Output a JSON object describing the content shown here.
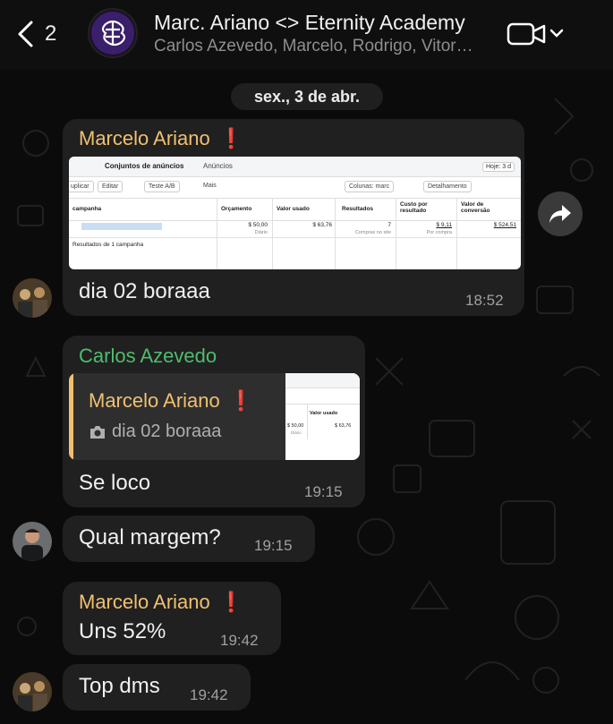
{
  "header": {
    "back_count": "2",
    "title": "Marc. Ariano <> Eternity Academy",
    "subtitle": "Carlos Azevedo, Marcelo, Rodrigo, Vitor…"
  },
  "date_separator": "sex., 3 de abr.",
  "messages": [
    {
      "sender": "Marcelo Ariano",
      "sender_badge": "❗",
      "text": "dia 02 boraaa",
      "time": "18:52",
      "image": {
        "tabs": [
          "Conjuntos de anúncios",
          "Anúncios"
        ],
        "date_button": "Hoje: 3 d",
        "toolbar": [
          "uplicar",
          "Editar",
          "Teste A/B",
          "Mais",
          "Colunas: marc",
          "Detalhamento"
        ],
        "columns": [
          "campanha",
          "Orçamento",
          "Valor usado",
          "Resultados",
          "Custo por resultado",
          "Valor de conversão"
        ],
        "row": {
          "orcamento": "$ 50,00",
          "orcamento_sub": "Diário",
          "valor_usado": "$ 63,76",
          "resultados": "7",
          "resultados_sub": "Compras no site",
          "custo": "$ 9,11",
          "custo_sub": "Por compra",
          "conversao": "$ 524,51"
        },
        "summary": "Resultados de 1 campanha"
      }
    },
    {
      "sender": "Carlos Azevedo",
      "quote": {
        "sender": "Marcelo Ariano",
        "sender_badge": "❗",
        "text": "dia 02 boraaa",
        "thumb": {
          "col1": "Valor usado",
          "v1": "$ 50,00",
          "v1_sub": "Diário",
          "v2": "$ 63,76"
        }
      },
      "text": "Se loco",
      "time": "19:15"
    },
    {
      "text": "Qual margem?",
      "time": "19:15"
    },
    {
      "sender": "Marcelo Ariano",
      "sender_badge": "❗",
      "text": "Uns 52%",
      "time": "19:42"
    },
    {
      "text": "Top dms",
      "time": "19:42"
    }
  ],
  "icons": {
    "back": "chevron-left-icon",
    "video": "video-camera-icon",
    "forward": "forward-icon",
    "camera": "camera-icon"
  },
  "colors": {
    "orange_sender": "#f0c070",
    "green_sender": "#4fbd6e",
    "bubble": "#202020"
  }
}
